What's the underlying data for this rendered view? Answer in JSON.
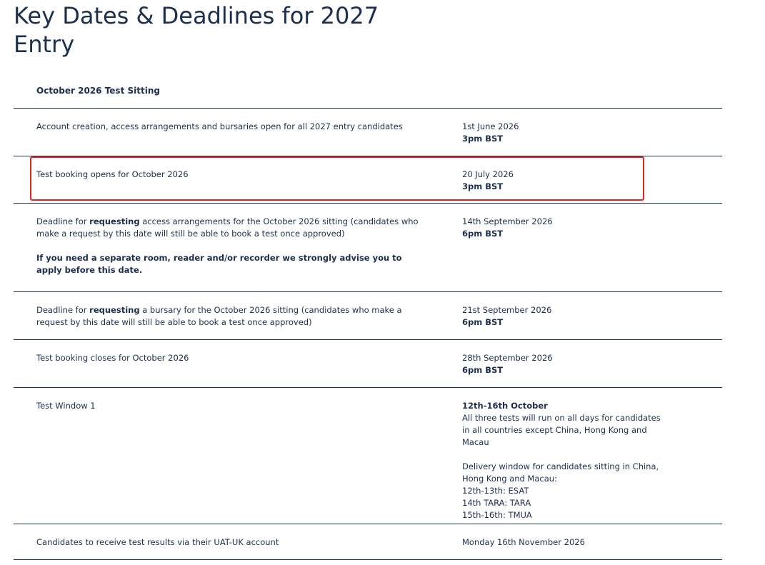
{
  "page": {
    "title": "Key Dates & Deadlines for 2027 Entry"
  },
  "table": {
    "section_header": "October 2026 Test Sitting",
    "rows": [
      {
        "event": "Account creation, access arrangements and bursaries open for all 2027 entry candidates",
        "date": "1st June 2026",
        "time": "3pm BST"
      },
      {
        "event": "Test booking opens for October 2026",
        "date": "20 July 2026",
        "time": "3pm BST"
      },
      {
        "event_prefix": "Deadline for ",
        "event_bold": "requesting",
        "event_suffix": " access arrangements for the October 2026 sitting (candidates who make a request by this date will still be able to book a test once approved)",
        "event_note": "If you need a separate room, reader and/or recorder we strongly advise you to apply before this date.",
        "date": "14th September 2026",
        "time": "6pm BST"
      },
      {
        "event_prefix": "Deadline for ",
        "event_bold": "requesting",
        "event_suffix": " a bursary for the October 2026 sitting (candidates who make a request by this date will still be able to book a test once approved)",
        "date": "21st September 2026",
        "time": "6pm BST"
      },
      {
        "event": "Test booking closes for October 2026",
        "date": "28th September 2026",
        "time": "6pm BST"
      },
      {
        "event": "Test Window 1",
        "date_bold": "12th-16th October",
        "date_text": "All three tests will run on all days for candidates in all countries except China, Hong Kong and Macau",
        "delivery_text": "Delivery window for candidates sitting in China, Hong Kong and Macau:",
        "delivery_items": [
          "12th-13th: ESAT",
          "14th TARA: TARA",
          "15th-16th: TMUA"
        ]
      },
      {
        "event": "Candidates to receive test results via their UAT-UK account",
        "date": "Monday 16th November 2026"
      }
    ]
  },
  "highlight": {
    "color": "#e8231f"
  }
}
